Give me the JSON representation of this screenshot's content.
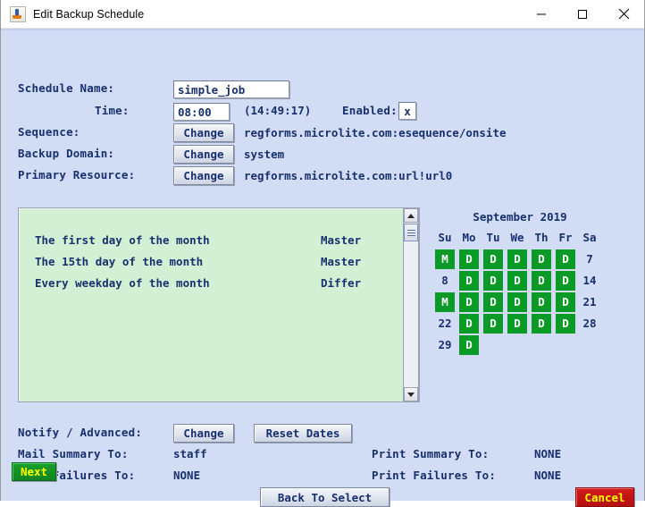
{
  "window": {
    "title": "Edit Backup Schedule",
    "icon": "java-coffee-cup-icon",
    "minimize_label": "─",
    "maximize_label": "□",
    "close_label": "✕"
  },
  "form": {
    "schedule_name_label": "Schedule Name:",
    "schedule_name_value": "simple_job",
    "time_label": "Time:",
    "time_value": "08:00",
    "clock_value": "(14:49:17)",
    "enabled_label": "Enabled:",
    "enabled_value": "x",
    "sequence_label": "Sequence:",
    "sequence_button": "Change",
    "sequence_value": "regforms.microlite.com:esequence/onsite",
    "backup_domain_label": "Backup Domain:",
    "backup_domain_button": "Change",
    "backup_domain_value": "system",
    "primary_resource_label": "Primary Resource:",
    "primary_resource_button": "Change",
    "primary_resource_value": "regforms.microlite.com:url!url0"
  },
  "schedule_list": {
    "rows": [
      {
        "description": "The first day of the month",
        "mode": "Master"
      },
      {
        "description": "The 15th day of the month",
        "mode": "Master"
      },
      {
        "description": "Every weekday of the month",
        "mode": "Differ"
      }
    ]
  },
  "calendar": {
    "title": "September 2019",
    "day_headers": [
      "Su",
      "Mo",
      "Tu",
      "We",
      "Th",
      "Fr",
      "Sa"
    ],
    "marked_color": "#0a9a26",
    "weeks": [
      [
        {
          "text": "M",
          "marked": true
        },
        {
          "text": "D",
          "marked": true
        },
        {
          "text": "D",
          "marked": true
        },
        {
          "text": "D",
          "marked": true
        },
        {
          "text": "D",
          "marked": true
        },
        {
          "text": "D",
          "marked": true
        },
        {
          "text": "7",
          "marked": false
        }
      ],
      [
        {
          "text": "8",
          "marked": false
        },
        {
          "text": "D",
          "marked": true
        },
        {
          "text": "D",
          "marked": true
        },
        {
          "text": "D",
          "marked": true
        },
        {
          "text": "D",
          "marked": true
        },
        {
          "text": "D",
          "marked": true
        },
        {
          "text": "14",
          "marked": false
        }
      ],
      [
        {
          "text": "M",
          "marked": true
        },
        {
          "text": "D",
          "marked": true
        },
        {
          "text": "D",
          "marked": true
        },
        {
          "text": "D",
          "marked": true
        },
        {
          "text": "D",
          "marked": true
        },
        {
          "text": "D",
          "marked": true
        },
        {
          "text": "21",
          "marked": false
        }
      ],
      [
        {
          "text": "22",
          "marked": false
        },
        {
          "text": "D",
          "marked": true
        },
        {
          "text": "D",
          "marked": true
        },
        {
          "text": "D",
          "marked": true
        },
        {
          "text": "D",
          "marked": true
        },
        {
          "text": "D",
          "marked": true
        },
        {
          "text": "28",
          "marked": false
        }
      ],
      [
        {
          "text": "29",
          "marked": false
        },
        {
          "text": "D",
          "marked": true
        },
        {
          "text": "",
          "marked": false
        },
        {
          "text": "",
          "marked": false
        },
        {
          "text": "",
          "marked": false
        },
        {
          "text": "",
          "marked": false
        },
        {
          "text": "",
          "marked": false
        }
      ]
    ]
  },
  "notify": {
    "label": "Notify / Advanced:",
    "change_button": "Change",
    "reset_button": "Reset Dates",
    "mail_summary_label": "Mail Summary To:",
    "mail_summary_value": "staff",
    "mail_failures_label": "Mail Failures To:",
    "mail_failures_value": "NONE",
    "print_summary_label": "Print Summary To:",
    "print_summary_value": "NONE",
    "print_failures_label": "Print Failures To:",
    "print_failures_value": "NONE"
  },
  "actions": {
    "next_label": "Next",
    "back_label": "Back To Select",
    "cancel_label": "Cancel"
  }
}
